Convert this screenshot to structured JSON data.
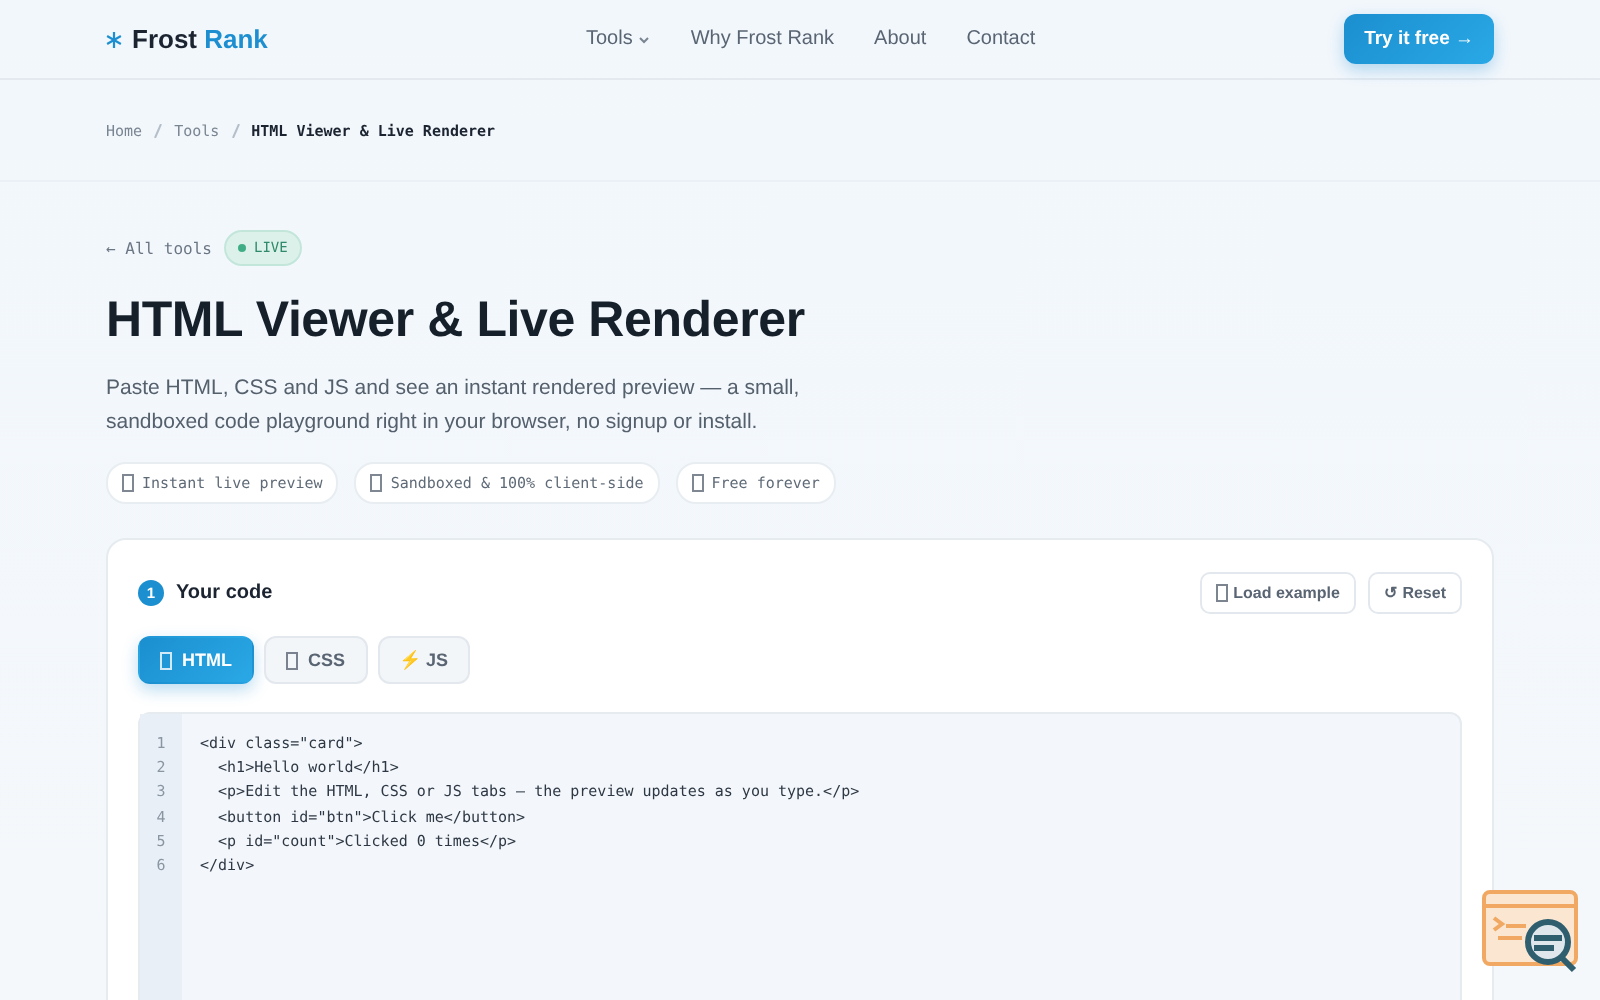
{
  "brand": {
    "first": "Frost",
    "second": "Rank"
  },
  "nav": [
    {
      "label": "Tools",
      "dropdown": true
    },
    {
      "label": "Why Frost Rank",
      "dropdown": false
    },
    {
      "label": "About",
      "dropdown": false
    },
    {
      "label": "Contact",
      "dropdown": false
    }
  ],
  "cta": "Try it free →",
  "breadcrumb": [
    {
      "label": "Home",
      "current": false
    },
    {
      "label": "Tools",
      "current": false
    },
    {
      "label": "HTML Viewer & Live Renderer",
      "current": true
    }
  ],
  "back_link": "← All tools",
  "status_badge": "LIVE",
  "title": "HTML Viewer & Live Renderer",
  "intro": "Paste HTML, CSS and JS and see an instant rendered preview — a small, sandboxed code playground right in your browser, no signup or install.",
  "features": [
    "Instant live preview",
    "Sandboxed & 100% client-side",
    "Free forever"
  ],
  "editor": {
    "step": "1",
    "heading": "Your code",
    "actions": [
      {
        "label": "Load example",
        "kind": "box"
      },
      {
        "label": "↺ Reset",
        "kind": "plain"
      }
    ],
    "tabs": [
      {
        "label": "HTML",
        "kind": "box",
        "selected": true
      },
      {
        "label": "CSS",
        "kind": "box",
        "selected": false
      },
      {
        "label": "⚡ JS",
        "kind": "plain",
        "selected": false
      }
    ],
    "lines": [
      {
        "number": "1",
        "code": "<div class=\"card\">"
      },
      {
        "number": "2",
        "code": "  <h1>Hello world</h1>"
      },
      {
        "number": "3",
        "code": "  <p>Edit the HTML, CSS or JS tabs — the preview updates as you type.</p>"
      },
      {
        "number": "4",
        "code": "  <button id=\"btn\">Click me</button>"
      },
      {
        "number": "5",
        "code": "  <p id=\"count\">Clicked 0 times</p>"
      },
      {
        "number": "6",
        "code": "</div>"
      }
    ]
  }
}
